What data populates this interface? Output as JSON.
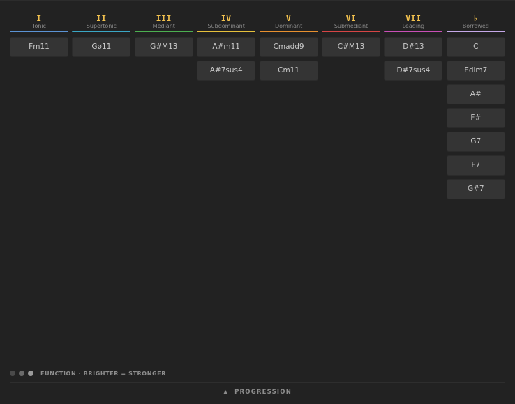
{
  "columns": [
    {
      "numeral": "I",
      "function": "Tonic",
      "color": "#5b93d4",
      "chords": [
        "Fm11"
      ]
    },
    {
      "numeral": "II",
      "function": "Supertonic",
      "color": "#3aa6c4",
      "chords": [
        "Gø11"
      ]
    },
    {
      "numeral": "III",
      "function": "Mediant",
      "color": "#4caf50",
      "chords": [
        "G#M13"
      ]
    },
    {
      "numeral": "IV",
      "function": "Subdominant",
      "color": "#e6c03c",
      "chords": [
        "A#m11",
        "A#7sus4"
      ]
    },
    {
      "numeral": "V",
      "function": "Dominant",
      "color": "#e8902f",
      "chords": [
        "Cmadd9",
        "Cm11"
      ]
    },
    {
      "numeral": "VI",
      "function": "Submediant",
      "color": "#d64545",
      "chords": [
        "C#M13"
      ]
    },
    {
      "numeral": "VII",
      "function": "Leading",
      "color": "#c94fb6",
      "chords": [
        "D#13",
        "D#7sus4"
      ]
    },
    {
      "numeral": "♭",
      "function": "Borrowed",
      "color": "#c5a8e8",
      "chords": [
        "C",
        "Edim7",
        "A#",
        "F#",
        "G7",
        "F7",
        "G#7"
      ]
    }
  ],
  "legend": {
    "dot_colors": [
      "#4a4a4a",
      "#6a6a6a",
      "#9a9a9a"
    ],
    "text": "FUNCTION · BRIGHTER = STRONGER"
  },
  "progression": {
    "icon": "triangle-up-icon",
    "label": "PROGRESSION"
  }
}
